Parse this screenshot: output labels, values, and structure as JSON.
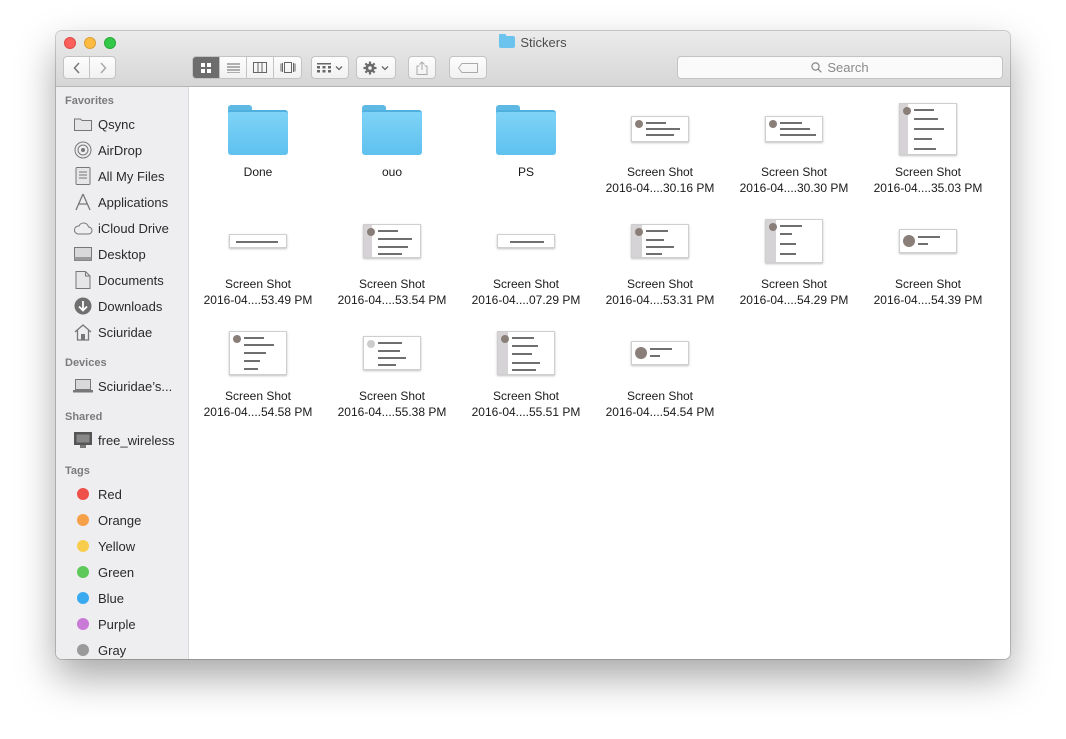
{
  "window": {
    "title": "Stickers"
  },
  "toolbar": {
    "back": "‹",
    "forward": "›",
    "search_placeholder": "Search"
  },
  "sidebar": {
    "favorites_header": "Favorites",
    "favorites": [
      {
        "label": "Qsync",
        "icon": "folder-icon"
      },
      {
        "label": "AirDrop",
        "icon": "airdrop-icon"
      },
      {
        "label": "All My Files",
        "icon": "all-files-icon"
      },
      {
        "label": "Applications",
        "icon": "applications-icon"
      },
      {
        "label": "iCloud Drive",
        "icon": "cloud-icon"
      },
      {
        "label": "Desktop",
        "icon": "desktop-icon"
      },
      {
        "label": "Documents",
        "icon": "documents-icon"
      },
      {
        "label": "Downloads",
        "icon": "downloads-icon"
      },
      {
        "label": "Sciuridae",
        "icon": "home-icon"
      }
    ],
    "devices_header": "Devices",
    "devices": [
      {
        "label": "Sciuridae’s...",
        "icon": "laptop-icon"
      }
    ],
    "shared_header": "Shared",
    "shared": [
      {
        "label": "free_wireless",
        "icon": "monitor-icon"
      }
    ],
    "tags_header": "Tags",
    "tags": [
      {
        "label": "Red",
        "color": "#f0504a"
      },
      {
        "label": "Orange",
        "color": "#f6a048"
      },
      {
        "label": "Yellow",
        "color": "#f8cd4e"
      },
      {
        "label": "Green",
        "color": "#5dc95a"
      },
      {
        "label": "Blue",
        "color": "#3aaaf0"
      },
      {
        "label": "Purple",
        "color": "#c979d6"
      },
      {
        "label": "Gray",
        "color": "#9a9a9a"
      }
    ]
  },
  "files": [
    {
      "line1": "Done",
      "line2": "",
      "kind": "folder"
    },
    {
      "line1": "ouo",
      "line2": "",
      "kind": "folder"
    },
    {
      "line1": "PS",
      "line2": "",
      "kind": "folder"
    },
    {
      "line1": "Screen Shot",
      "line2": "2016-04....30.16 PM",
      "kind": "shot"
    },
    {
      "line1": "Screen Shot",
      "line2": "2016-04....30.30 PM",
      "kind": "shot"
    },
    {
      "line1": "Screen Shot",
      "line2": "2016-04....35.03 PM",
      "kind": "shot"
    },
    {
      "line1": "Screen Shot",
      "line2": "2016-04....53.49 PM",
      "kind": "shot"
    },
    {
      "line1": "Screen Shot",
      "line2": "2016-04....53.54 PM",
      "kind": "shot"
    },
    {
      "line1": "Screen Shot",
      "line2": "2016-04....07.29 PM",
      "kind": "shot"
    },
    {
      "line1": "Screen Shot",
      "line2": "2016-04....53.31 PM",
      "kind": "shot"
    },
    {
      "line1": "Screen Shot",
      "line2": "2016-04....54.29 PM",
      "kind": "shot"
    },
    {
      "line1": "Screen Shot",
      "line2": "2016-04....54.39 PM",
      "kind": "shot"
    },
    {
      "line1": "Screen Shot",
      "line2": "2016-04....54.58 PM",
      "kind": "shot"
    },
    {
      "line1": "Screen Shot",
      "line2": "2016-04....55.38 PM",
      "kind": "shot"
    },
    {
      "line1": "Screen Shot",
      "line2": "2016-04....55.51 PM",
      "kind": "shot"
    },
    {
      "line1": "Screen Shot",
      "line2": "2016-04....54.54 PM",
      "kind": "shot"
    }
  ]
}
